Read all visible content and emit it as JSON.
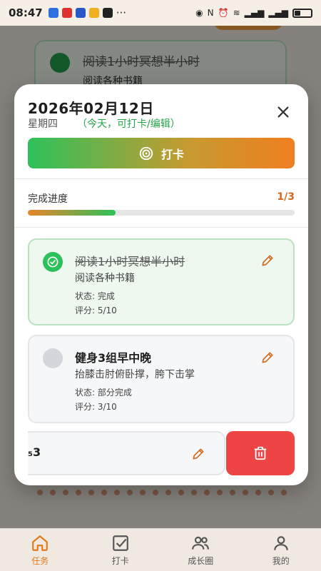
{
  "status_bar": {
    "time": "08:47",
    "more": "···"
  },
  "background": {
    "task_title": "阅读1小时冥想半小时",
    "task_desc": "阅读各种书籍"
  },
  "modal": {
    "date": "2026年02月12日",
    "weekday": "星期四",
    "today_note": "（今天，可打卡/编辑）",
    "checkin_label": "打卡",
    "progress_label": "完成进度",
    "progress_count": "1/3",
    "progress_fraction": 0.33,
    "tasks": [
      {
        "title": "阅读1小时冥想半小时",
        "desc": "阅读各种书籍",
        "status": "状态: 完成",
        "score": "评分: 5/10"
      },
      {
        "title": "健身3组早中晚",
        "desc": "抬膝击肘俯卧撑，胯下击掌",
        "status": "状态: 部分完成",
        "score": "评分: 3/10"
      }
    ],
    "swiped_task_title_fragment": "₅3"
  },
  "bottom_nav": {
    "items": [
      {
        "label": "任务",
        "icon": "home-icon"
      },
      {
        "label": "打卡",
        "icon": "checkbox-icon"
      },
      {
        "label": "成长圈",
        "icon": "users-icon"
      },
      {
        "label": "我的",
        "icon": "user-icon"
      }
    ]
  },
  "colors": {
    "accent": "#e07a1c",
    "success": "#2cc15a",
    "danger": "#ef4444"
  }
}
